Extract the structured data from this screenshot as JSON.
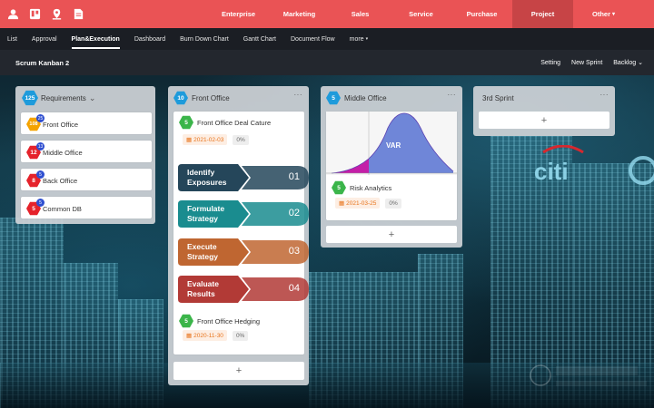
{
  "nav": {
    "icons": [
      "user-icon",
      "board-icon",
      "location-icon",
      "document-icon"
    ],
    "modules": [
      {
        "label": "Enterprise",
        "active": false
      },
      {
        "label": "Marketing",
        "active": false
      },
      {
        "label": "Sales",
        "active": false
      },
      {
        "label": "Service",
        "active": false
      },
      {
        "label": "Purchase",
        "active": false
      },
      {
        "label": "Project",
        "active": true
      },
      {
        "label": "Other",
        "active": false
      }
    ]
  },
  "subnav": [
    "List",
    "Approval",
    "Plan&Execution",
    "Dashboard",
    "Burn Down Chart",
    "Gantt Chart",
    "Document Flow",
    "more"
  ],
  "subnav_active": "Plan&Execution",
  "board": {
    "title": "Scrum Kanban 2",
    "actions": [
      "Setting",
      "New Sprint",
      "Backlog"
    ]
  },
  "columns": {
    "requirements": {
      "count": "125",
      "title": "Requirements",
      "items": [
        {
          "count": "108",
          "badge": "25",
          "title": "Front Office",
          "color": "#f5a300"
        },
        {
          "count": "12",
          "badge": "13",
          "title": "Middle Office",
          "color": "#e5222b"
        },
        {
          "count": "8",
          "badge": "5",
          "title": "Back Office",
          "color": "#e5222b"
        },
        {
          "count": "5",
          "badge": "5",
          "title": "Common DB",
          "color": "#e5222b"
        }
      ]
    },
    "front_office": {
      "count": "10",
      "title": "Front Office",
      "card1": {
        "count": "5",
        "title": "Front Office Deal Cature",
        "date": "2021-02-03",
        "pct": "0%"
      },
      "steps": [
        {
          "line1": "Identify",
          "line2": "Exposures",
          "num": "01",
          "color": "#25465a"
        },
        {
          "line1": "Formulate",
          "line2": "Strategy",
          "num": "02",
          "color": "#1a8c8f"
        },
        {
          "line1": "Execute",
          "line2": "Strategy",
          "num": "03",
          "color": "#bf6631"
        },
        {
          "line1": "Evaluate",
          "line2": "Results",
          "num": "04",
          "color": "#b23a36"
        }
      ],
      "card2": {
        "count": "5",
        "title": "Front Office Hedging",
        "date": "2020-11-30",
        "pct": "0%"
      }
    },
    "middle_office": {
      "count": "5",
      "title": "Middle Office",
      "chart_label": "VAR",
      "card1": {
        "count": "5",
        "title": "Risk Analytics",
        "date": "2021-03-25",
        "pct": "0%"
      }
    },
    "sprint3": {
      "title": "3rd Sprint"
    }
  },
  "add_symbol": "+",
  "menu_symbol": "···",
  "colors": {
    "topbar": "#ea5355",
    "active_module": "#c74446",
    "subnav": "#1b1e24",
    "boardbar": "#23272e",
    "date": "#e8741c"
  }
}
